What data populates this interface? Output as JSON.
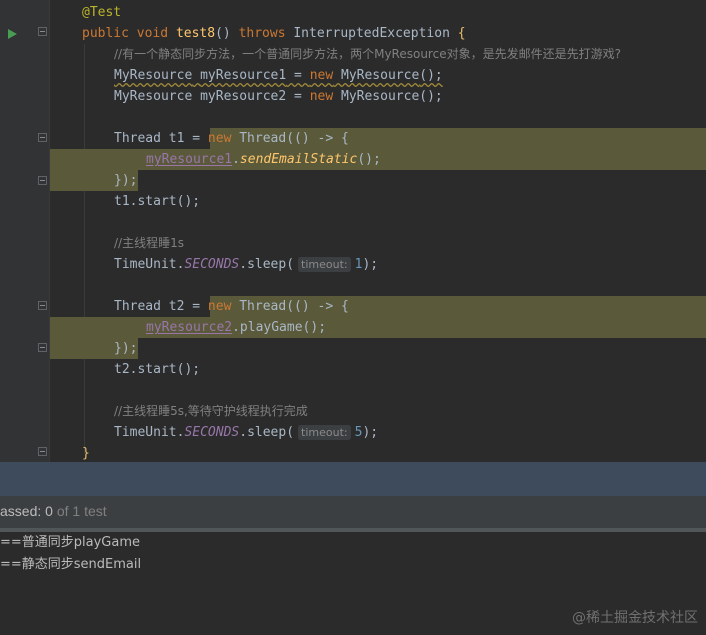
{
  "editor": {
    "lines": {
      "annotation": "@Test",
      "sig_public": "public",
      "sig_void": "void",
      "sig_name": "test8",
      "sig_parens": "()",
      "sig_throws": "throws",
      "sig_exc": "InterruptedException",
      "sig_brace": "{",
      "comment1": "//有一个静态同步方法，一个普通同步方法，两个MyResource对象，是先发邮件还是先打游戏?",
      "r1_type": "MyResource",
      "r1_var": "myResource1",
      "r1_eq": " = ",
      "r1_new": "new",
      "r1_ctor": " MyResource",
      "r1_end": "();",
      "r2_type": "MyResource",
      "r2_var": "myResource2",
      "r2_eq": " = ",
      "r2_new": "new",
      "r2_ctor": " MyResource",
      "r2_end": "();",
      "t1_decl": "Thread t1 = ",
      "t1_new": "new",
      "t1_thread": " Thread",
      "t1_lambda": "(() -> {",
      "t1_field": "myResource1",
      "t1_dot": ".",
      "t1_call": "sendEmailStatic",
      "t1_callend": "();",
      "t1_close": "});",
      "t1_start": "t1.start();",
      "comment2": "//主线程睡1s",
      "sleep1_class": "TimeUnit.",
      "sleep1_const": "SECONDS",
      "sleep1_method": ".sleep(",
      "sleep1_hint": "timeout:",
      "sleep1_num": "1",
      "sleep1_end": ");",
      "t2_decl": "Thread t2 = ",
      "t2_new": "new",
      "t2_thread": " Thread",
      "t2_lambda": "(() -> {",
      "t2_field": "myResource2",
      "t2_dot": ".",
      "t2_call": "playGame",
      "t2_callend": "();",
      "t2_close": "});",
      "t2_start": "t2.start();",
      "comment3": "//主线程睡5s,等待守护线程执行完成",
      "sleep2_class": "TimeUnit.",
      "sleep2_const": "SECONDS",
      "sleep2_method": ".sleep(",
      "sleep2_hint": "timeout:",
      "sleep2_num": "5",
      "sleep2_end": ");",
      "closing": "}"
    }
  },
  "tests": {
    "passed_label": "assed: ",
    "passed_count": "0",
    "rest": " of 1 test"
  },
  "console": {
    "line1": "==普通同步playGame",
    "line2": "==静态同步sendEmail"
  },
  "watermark": "@稀土掘金技术社区",
  "colors": {
    "keyword": "#cc7832",
    "method": "#ffc66d",
    "comment": "#808080",
    "field": "#9876aa",
    "number": "#6897bb",
    "highlight": "#5a5a3a",
    "status_strip": "#3d4b5c"
  },
  "icons": [
    "run-test-icon",
    "fold-icon"
  ]
}
